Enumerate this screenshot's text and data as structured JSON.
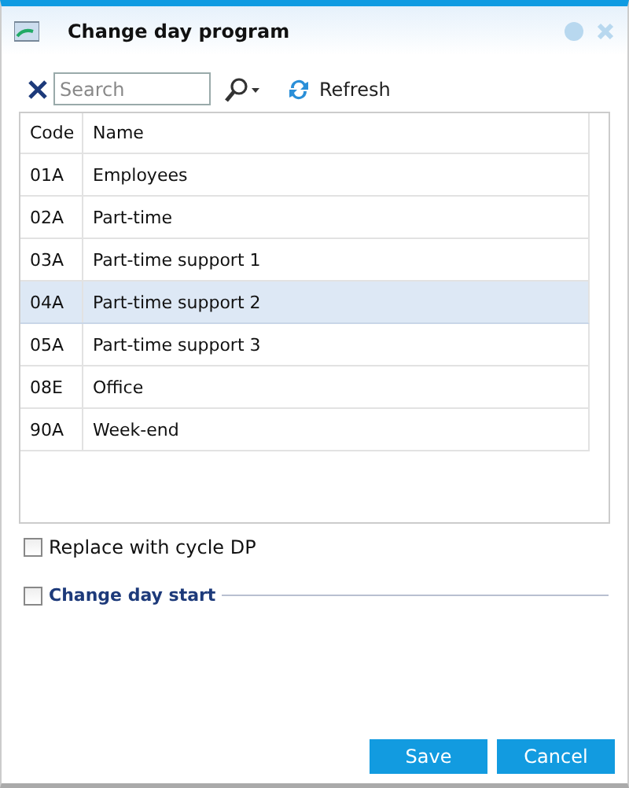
{
  "window": {
    "title": "Change day program"
  },
  "toolbar": {
    "search": {
      "placeholder": "Search"
    },
    "refresh": "Refresh"
  },
  "table": {
    "columns": [
      "Code",
      "Name"
    ],
    "rows": [
      {
        "code": "01A",
        "name": "Employees",
        "selected": false
      },
      {
        "code": "02A",
        "name": "Part-time",
        "selected": false
      },
      {
        "code": "03A",
        "name": "Part-time support 1",
        "selected": false
      },
      {
        "code": "04A",
        "name": "Part-time support 2",
        "selected": true
      },
      {
        "code": "05A",
        "name": "Part-time support 3",
        "selected": false
      },
      {
        "code": "08E",
        "name": "Office",
        "selected": false
      },
      {
        "code": "90A",
        "name": "Week-end",
        "selected": false
      }
    ]
  },
  "replace_with_cycle": {
    "label": "Replace with cycle DP",
    "checked": false
  },
  "change_day_start": {
    "label": "Change day start",
    "checked": false
  },
  "buttons": [
    "Save",
    "Cancel"
  ]
}
